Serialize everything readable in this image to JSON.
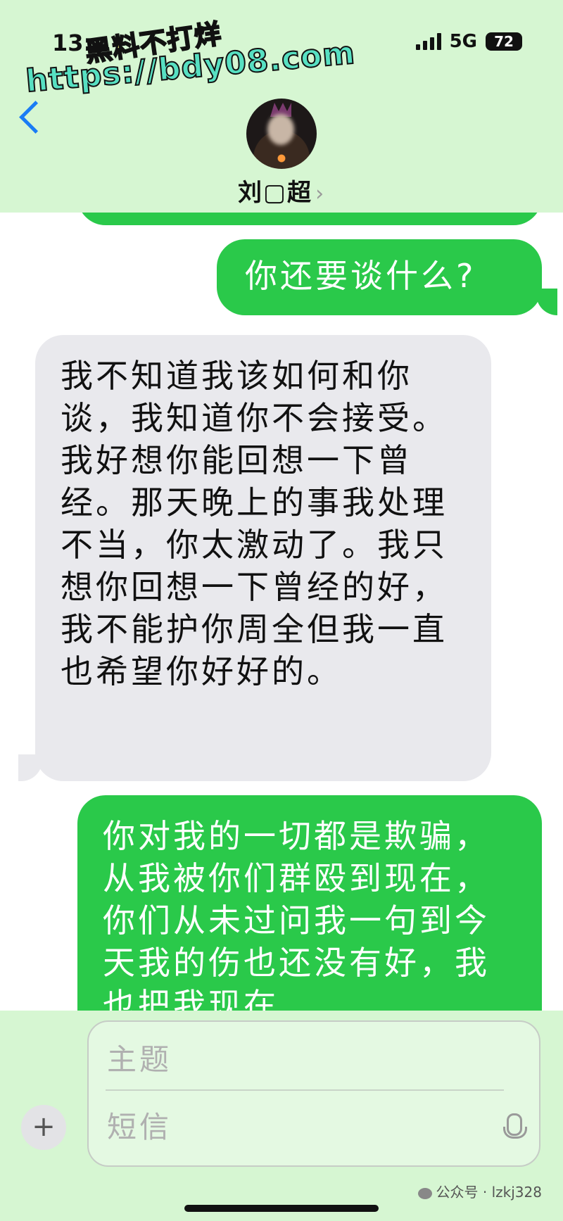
{
  "status_bar": {
    "time": "13:",
    "network": "5G",
    "battery": "72"
  },
  "watermark": {
    "line1": "黑料不打烊",
    "line2": "https://bdy08.com"
  },
  "contact": {
    "name": "刘▢超",
    "chevron": "›"
  },
  "messages": [
    {
      "direction": "sent",
      "text": "你还要谈什么?"
    },
    {
      "direction": "received",
      "text": "我不知道我该如何和你谈，我知道你不会接受。我好想你能回想一下曾经。那天晚上的事我处理不当，你太激动了。我只想你回想一下曾经的好，我不能护你周全但我一直也希望你好好的。"
    },
    {
      "direction": "sent",
      "text": "你对我的一切都是欺骗，从我被你们群殴到现在，你们从未过问我一句到今天我的伤也还没有好，我也把我现在"
    }
  ],
  "composer": {
    "add_label": "+",
    "subject_placeholder": "主题",
    "message_placeholder": "短信"
  },
  "footer": {
    "watermark": "公众号 · lzkj328"
  },
  "colors": {
    "header_bg": "#d6f6d2",
    "sent_bubble": "#2ac94a",
    "received_bubble": "#e9e9ed",
    "back_arrow": "#1a7cf5"
  },
  "icons": [
    "back-icon",
    "signal-icon",
    "battery-icon",
    "mic-icon",
    "plus-icon",
    "wechat-icon"
  ]
}
